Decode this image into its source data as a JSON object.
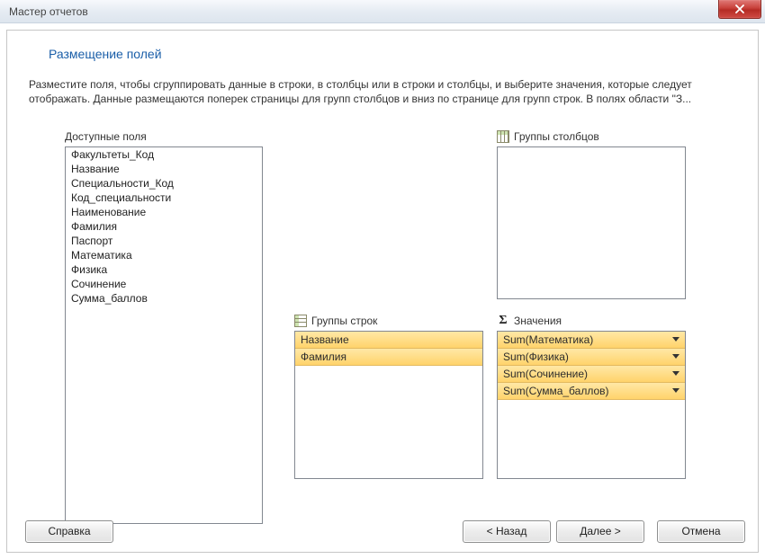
{
  "window": {
    "title": "Мастер отчетов"
  },
  "page": {
    "heading": "Размещение полей",
    "description": "Разместите поля, чтобы сгруппировать данные в строки, в столбцы или в строки и столбцы, и выберите значения, которые следует отображать. Данные размещаются поперек страницы для групп столбцов и вниз по странице для групп строк. В полях области \"З..."
  },
  "panels": {
    "available": {
      "label": "Доступные поля",
      "items": [
        "Факультеты_Код",
        "Название",
        "Специальности_Код",
        "Код_специальности",
        "Наименование",
        "Фамилия",
        "Паспорт",
        "Математика",
        "Физика",
        "Сочинение",
        "Сумма_баллов"
      ]
    },
    "col_groups": {
      "label": "Группы столбцов"
    },
    "row_groups": {
      "label": "Группы строк",
      "items": [
        "Название",
        "Фамилия"
      ]
    },
    "values": {
      "label": "Значения",
      "items": [
        "Sum(Математика)",
        "Sum(Физика)",
        "Sum(Сочинение)",
        "Sum(Сумма_баллов)"
      ]
    }
  },
  "buttons": {
    "help": "Справка",
    "back": "< Назад",
    "next": "Далее >",
    "cancel": "Отмена"
  }
}
